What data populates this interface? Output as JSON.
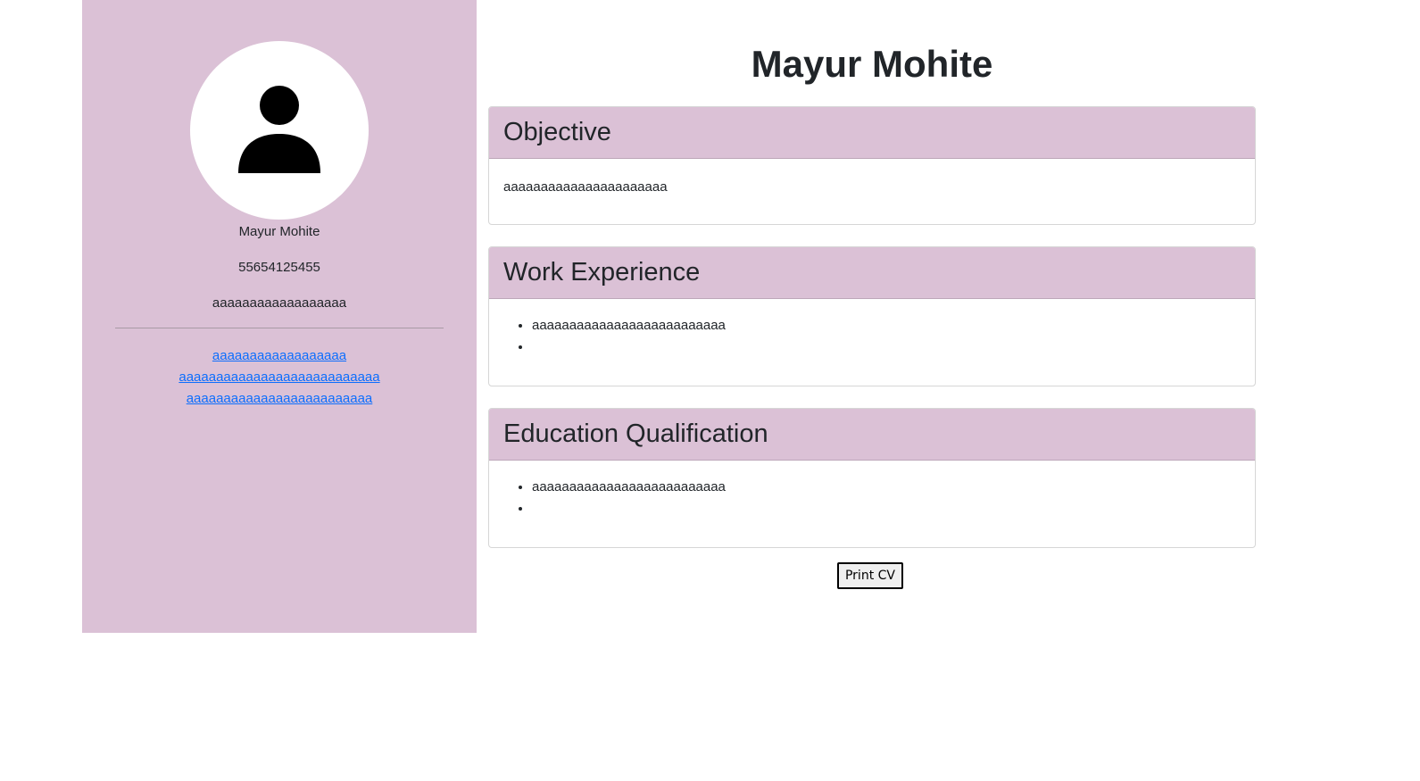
{
  "sidebar": {
    "avatar_icon": "person-icon",
    "name": "Mayur Mohite",
    "phone": "55654125455",
    "email": "aaaaaaaaaaaaaaaaaa",
    "links": [
      "aaaaaaaaaaaaaaaaaa",
      "aaaaaaaaaaaaaaaaaaaaaaaaaaa",
      "aaaaaaaaaaaaaaaaaaaaaaaaa"
    ]
  },
  "main": {
    "title": "Mayur Mohite",
    "objective": {
      "heading": "Objective",
      "text": "aaaaaaaaaaaaaaaaaaaaaa"
    },
    "work": {
      "heading": "Work Experience",
      "items": [
        "aaaaaaaaaaaaaaaaaaaaaaaaaa",
        ""
      ]
    },
    "education": {
      "heading": "Education Qualification",
      "items": [
        "aaaaaaaaaaaaaaaaaaaaaaaaaa",
        ""
      ]
    },
    "print_button": "Print CV"
  },
  "colors": {
    "accent": "#dbc1d6",
    "link": "#0d6efd",
    "text": "#212529"
  }
}
